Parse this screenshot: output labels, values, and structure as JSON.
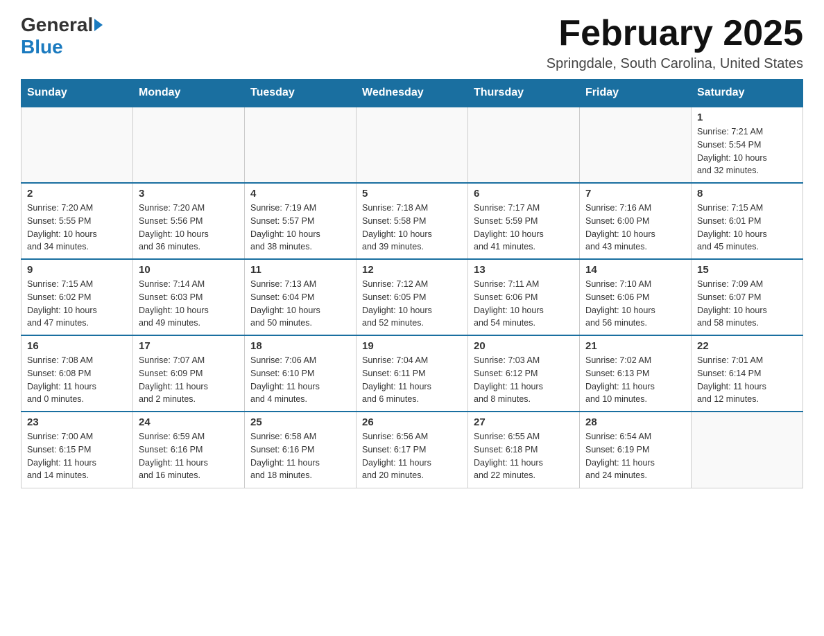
{
  "logo": {
    "general": "General",
    "blue": "Blue"
  },
  "title": {
    "month_year": "February 2025",
    "location": "Springdale, South Carolina, United States"
  },
  "weekdays": [
    "Sunday",
    "Monday",
    "Tuesday",
    "Wednesday",
    "Thursday",
    "Friday",
    "Saturday"
  ],
  "weeks": [
    [
      {
        "day": "",
        "info": ""
      },
      {
        "day": "",
        "info": ""
      },
      {
        "day": "",
        "info": ""
      },
      {
        "day": "",
        "info": ""
      },
      {
        "day": "",
        "info": ""
      },
      {
        "day": "",
        "info": ""
      },
      {
        "day": "1",
        "info": "Sunrise: 7:21 AM\nSunset: 5:54 PM\nDaylight: 10 hours\nand 32 minutes."
      }
    ],
    [
      {
        "day": "2",
        "info": "Sunrise: 7:20 AM\nSunset: 5:55 PM\nDaylight: 10 hours\nand 34 minutes."
      },
      {
        "day": "3",
        "info": "Sunrise: 7:20 AM\nSunset: 5:56 PM\nDaylight: 10 hours\nand 36 minutes."
      },
      {
        "day": "4",
        "info": "Sunrise: 7:19 AM\nSunset: 5:57 PM\nDaylight: 10 hours\nand 38 minutes."
      },
      {
        "day": "5",
        "info": "Sunrise: 7:18 AM\nSunset: 5:58 PM\nDaylight: 10 hours\nand 39 minutes."
      },
      {
        "day": "6",
        "info": "Sunrise: 7:17 AM\nSunset: 5:59 PM\nDaylight: 10 hours\nand 41 minutes."
      },
      {
        "day": "7",
        "info": "Sunrise: 7:16 AM\nSunset: 6:00 PM\nDaylight: 10 hours\nand 43 minutes."
      },
      {
        "day": "8",
        "info": "Sunrise: 7:15 AM\nSunset: 6:01 PM\nDaylight: 10 hours\nand 45 minutes."
      }
    ],
    [
      {
        "day": "9",
        "info": "Sunrise: 7:15 AM\nSunset: 6:02 PM\nDaylight: 10 hours\nand 47 minutes."
      },
      {
        "day": "10",
        "info": "Sunrise: 7:14 AM\nSunset: 6:03 PM\nDaylight: 10 hours\nand 49 minutes."
      },
      {
        "day": "11",
        "info": "Sunrise: 7:13 AM\nSunset: 6:04 PM\nDaylight: 10 hours\nand 50 minutes."
      },
      {
        "day": "12",
        "info": "Sunrise: 7:12 AM\nSunset: 6:05 PM\nDaylight: 10 hours\nand 52 minutes."
      },
      {
        "day": "13",
        "info": "Sunrise: 7:11 AM\nSunset: 6:06 PM\nDaylight: 10 hours\nand 54 minutes."
      },
      {
        "day": "14",
        "info": "Sunrise: 7:10 AM\nSunset: 6:06 PM\nDaylight: 10 hours\nand 56 minutes."
      },
      {
        "day": "15",
        "info": "Sunrise: 7:09 AM\nSunset: 6:07 PM\nDaylight: 10 hours\nand 58 minutes."
      }
    ],
    [
      {
        "day": "16",
        "info": "Sunrise: 7:08 AM\nSunset: 6:08 PM\nDaylight: 11 hours\nand 0 minutes."
      },
      {
        "day": "17",
        "info": "Sunrise: 7:07 AM\nSunset: 6:09 PM\nDaylight: 11 hours\nand 2 minutes."
      },
      {
        "day": "18",
        "info": "Sunrise: 7:06 AM\nSunset: 6:10 PM\nDaylight: 11 hours\nand 4 minutes."
      },
      {
        "day": "19",
        "info": "Sunrise: 7:04 AM\nSunset: 6:11 PM\nDaylight: 11 hours\nand 6 minutes."
      },
      {
        "day": "20",
        "info": "Sunrise: 7:03 AM\nSunset: 6:12 PM\nDaylight: 11 hours\nand 8 minutes."
      },
      {
        "day": "21",
        "info": "Sunrise: 7:02 AM\nSunset: 6:13 PM\nDaylight: 11 hours\nand 10 minutes."
      },
      {
        "day": "22",
        "info": "Sunrise: 7:01 AM\nSunset: 6:14 PM\nDaylight: 11 hours\nand 12 minutes."
      }
    ],
    [
      {
        "day": "23",
        "info": "Sunrise: 7:00 AM\nSunset: 6:15 PM\nDaylight: 11 hours\nand 14 minutes."
      },
      {
        "day": "24",
        "info": "Sunrise: 6:59 AM\nSunset: 6:16 PM\nDaylight: 11 hours\nand 16 minutes."
      },
      {
        "day": "25",
        "info": "Sunrise: 6:58 AM\nSunset: 6:16 PM\nDaylight: 11 hours\nand 18 minutes."
      },
      {
        "day": "26",
        "info": "Sunrise: 6:56 AM\nSunset: 6:17 PM\nDaylight: 11 hours\nand 20 minutes."
      },
      {
        "day": "27",
        "info": "Sunrise: 6:55 AM\nSunset: 6:18 PM\nDaylight: 11 hours\nand 22 minutes."
      },
      {
        "day": "28",
        "info": "Sunrise: 6:54 AM\nSunset: 6:19 PM\nDaylight: 11 hours\nand 24 minutes."
      },
      {
        "day": "",
        "info": ""
      }
    ]
  ]
}
